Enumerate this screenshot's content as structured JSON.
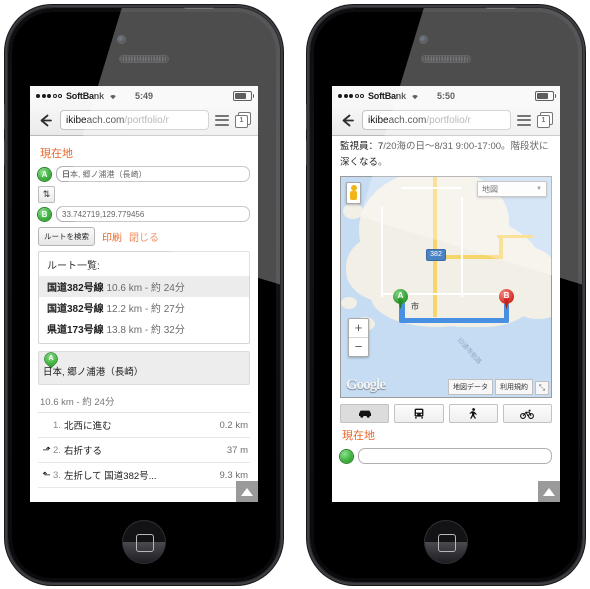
{
  "left_phone": {
    "status": {
      "carrier": "SoftBank",
      "time": "5:49",
      "signal_filled": 3,
      "signal_empty": 2
    },
    "browser": {
      "url_visible": "ikibeach.com",
      "url_dim": "/portfolio/r",
      "tab_count": "1"
    },
    "section_title": "現在地",
    "fields": [
      {
        "marker": "A",
        "value": "日本, 郷ノ浦港（長崎）"
      },
      {
        "marker": "B",
        "value": "33.742719,129.779456"
      }
    ],
    "swap_label": "⇅",
    "buttons": {
      "search": "ルートを検索",
      "print": "印刷",
      "close": "閉じる"
    },
    "route_list": {
      "title": "ルート一覧:",
      "items": [
        {
          "road": "国道382号線",
          "detail": "10.6 km - 約 24分",
          "selected": true
        },
        {
          "road": "国道382号線",
          "detail": "12.2 km - 約 27分",
          "selected": false
        },
        {
          "road": "県道173号線",
          "detail": "13.8 km - 約 32分",
          "selected": false
        }
      ]
    },
    "origin": {
      "marker": "A",
      "text": "日本, 郷ノ浦港（長崎）"
    },
    "summary": "10.6 km - 約 24分",
    "steps": [
      {
        "icon": "",
        "num": "1.",
        "text": "北西に進む",
        "dist": "0.2 km"
      },
      {
        "icon": "⬏",
        "num": "2.",
        "text": "右折する",
        "dist": "37 m"
      },
      {
        "icon": "⬑",
        "num": "3.",
        "text": "左折して 国道382号...",
        "dist": "9.3 km"
      }
    ],
    "scroll_top_label": "▲"
  },
  "right_phone": {
    "status": {
      "carrier": "SoftBank",
      "time": "5:50",
      "signal_filled": 3,
      "signal_empty": 2
    },
    "browser": {
      "url_visible": "ikibeach.com",
      "url_dim": "/portfolio/r",
      "tab_count": "1"
    },
    "body_text": "監視員：7/20海の日〜8/31 9:00-17:00。階段状に深くなる。",
    "map": {
      "type_label": "地図",
      "zoom_in": "+",
      "zoom_out": "−",
      "logo": "Google",
      "attribution": [
        "地図データ",
        "利用規約"
      ],
      "resize_label": "⤡",
      "markers": [
        {
          "label": "A",
          "color": "#36a336"
        },
        {
          "label": "B",
          "color": "#e2332b"
        }
      ],
      "route_shield": "382",
      "sea_label": "印通寺航路",
      "city_label": "市"
    },
    "travel_modes": [
      "car-icon",
      "transit-icon",
      "walk-icon",
      "bike-icon"
    ],
    "active_mode_index": 0,
    "section_title": "現在地",
    "scroll_top_label": "▲"
  },
  "colors": {
    "accent_orange": "#e8662a",
    "marker_green": "#36a336",
    "marker_red": "#e2332b",
    "route_blue": "#4a90e2",
    "map_land": "#f2efe6",
    "map_water": "#c6dcf2",
    "highway_yellow": "#f6d66a"
  }
}
